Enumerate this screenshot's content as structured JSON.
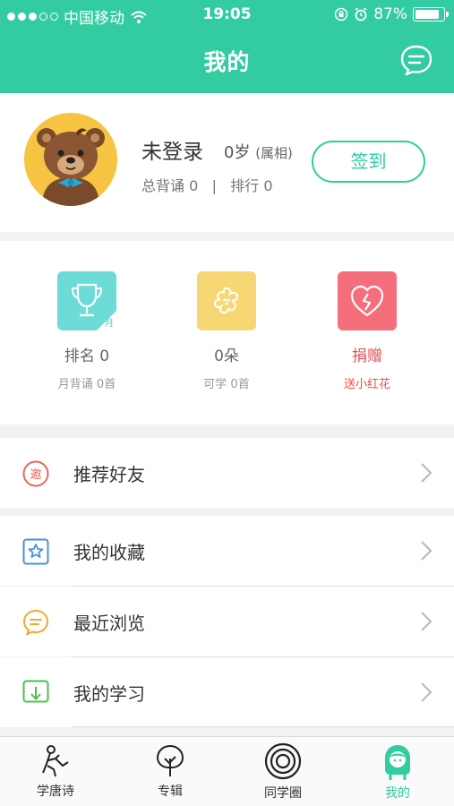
{
  "status_bar": {
    "carrier": "中国移动",
    "time": "19:05",
    "battery": "87%",
    "battery_level": 0.87
  },
  "header": {
    "title": "我的",
    "message_icon": "chat-bubble-icon"
  },
  "profile": {
    "name": "未登录",
    "age": "0岁",
    "zodiac": "(属相)",
    "total_label": "总背诵",
    "total_value": "0",
    "separator": "|",
    "rank_label": "排行",
    "rank_value": "0",
    "checkin_label": "签到"
  },
  "stats": [
    {
      "icon": "trophy-icon",
      "value": "排名  0",
      "sub": "月背诵  0首",
      "badge": "月",
      "color": "#6ddbd6"
    },
    {
      "icon": "flower-icon",
      "value": "0朵",
      "sub": "可学  0首",
      "color": "#f7d774"
    },
    {
      "icon": "heart-icon",
      "value": "捐赠",
      "sub": "送小红花",
      "color": "#f46e7b"
    }
  ],
  "menu": [
    {
      "label": "推荐好友",
      "icon": "invite-icon",
      "icon_text": "邀",
      "color": "#e8675a"
    },
    {
      "label": "我的收藏",
      "icon": "star-icon",
      "color": "#4a8fe0"
    },
    {
      "label": "最近浏览",
      "icon": "chat-icon",
      "color": "#f0a830"
    },
    {
      "label": "我的学习",
      "icon": "download-icon",
      "color": "#4cc04c"
    }
  ],
  "tabs": [
    {
      "label": "学唐诗",
      "icon": "poet-icon",
      "active": false
    },
    {
      "label": "专辑",
      "icon": "tree-icon",
      "active": false
    },
    {
      "label": "同学圈",
      "icon": "circles-icon",
      "active": false
    },
    {
      "label": "我的",
      "icon": "girl-icon",
      "active": true
    }
  ],
  "colors": {
    "accent": "#33cba0",
    "danger": "#e05050"
  }
}
